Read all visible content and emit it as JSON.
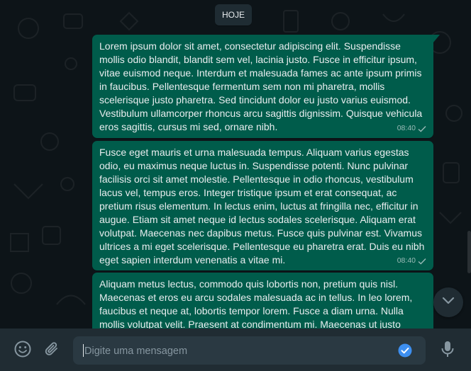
{
  "date_chip": "HOJE",
  "messages": [
    {
      "text": "Lorem ipsum dolor sit amet, consectetur adipiscing elit. Suspendisse mollis odio blandit, blandit sem vel, lacinia justo. Fusce in efficitur ipsum, vitae euismod neque. Interdum et malesuada fames ac ante ipsum primis in faucibus. Pellentesque fermentum sem non mi pharetra, mollis scelerisque justo pharetra. Sed tincidunt dolor eu justo varius euismod. Vestibulum ullamcorper rhoncus arcu sagittis dignissim. Quisque vehicula eros sagittis, cursus mi sed, ornare nibh.",
      "time": "08:40",
      "status_icon": "single-check-icon"
    },
    {
      "text": "Fusce eget mauris et urna malesuada tempus. Aliquam varius egestas odio, eu maximus neque luctus in. Suspendisse potenti. Nunc pulvinar facilisis orci sit amet molestie. Pellentesque in odio rhoncus, vestibulum lacus vel, tempus eros. Integer tristique ipsum et erat consequat, ac pretium risus elementum. In lectus enim, luctus at fringilla nec, efficitur in augue. Etiam sit amet neque id lectus sodales scelerisque. Aliquam erat volutpat. Maecenas nec dapibus metus. Fusce quis pulvinar est. Vivamus ultrices a mi eget scelerisque. Pellentesque eu pharetra erat. Duis eu nibh eget sapien interdum venenatis a vitae mi.",
      "time": "08:40",
      "status_icon": "single-check-icon"
    },
    {
      "text": "Aliquam metus lectus, commodo quis lobortis non, pretium quis nisl. Maecenas et eros eu arcu sodales malesuada ac in tellus. In leo lorem, faucibus et neque at, lobortis tempor lorem. Fusce a diam urna. Nulla mollis volutpat velit. Praesent at condimentum mi. Maecenas ut justo",
      "time": "",
      "status_icon": ""
    }
  ],
  "composer": {
    "placeholder": "Digite uma mensagem",
    "value": ""
  },
  "icons": {
    "emoji": "emoji-icon",
    "attach": "paperclip-icon",
    "grammar": "grammar-check-icon",
    "mic": "microphone-icon",
    "scroll_down": "chevron-down-icon"
  },
  "colors": {
    "outgoing_bubble": "#005c4b",
    "background": "#0d1418",
    "footer": "#202c33",
    "composer": "#2a3942",
    "text": "#e9edef"
  }
}
